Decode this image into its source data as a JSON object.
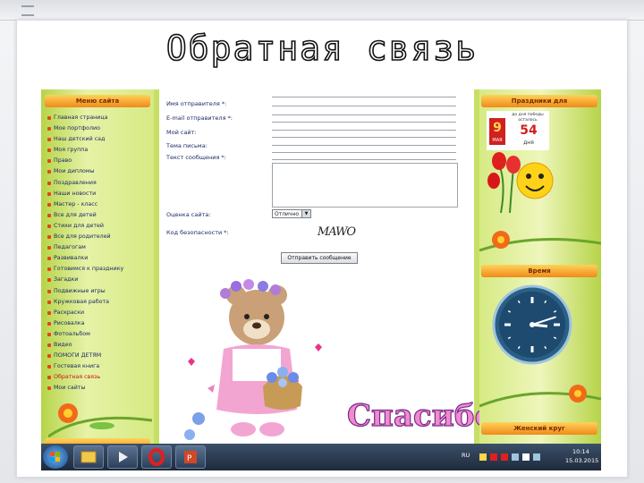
{
  "slide": {
    "title": "Обратная связь"
  },
  "site": {
    "left_block": {
      "header": "Меню сайта"
    },
    "menu_items": [
      "Главная страница",
      "Мое портфолио",
      "Наш детский сад",
      "Моя группа",
      "Право",
      "Мои дипломы",
      "Поздравления",
      "Наши новости",
      "Мастер - класс",
      "Все для детей",
      "Стихи для детей",
      "Все для родителей",
      "Педагогам",
      "Развивалки",
      "Готовимся к празднику",
      "Загадки",
      "Подвижные игры",
      "Кружковая работа",
      "Раскраски",
      "Рисовалка",
      "Фотоальбом",
      "Видео",
      "ПОМОГИ ДЕТЯМ",
      "Гостевая книга",
      "Обратная связь",
      "Мои сайты"
    ],
    "active_menu_item": "Обратная связь",
    "form": {
      "name_label": "Имя отправителя *:",
      "email_label": "E-mail отправителя *:",
      "site_label": "Мой сайт:",
      "subject_label": "Тема письма:",
      "message_label": "Текст сообщения *:",
      "rating_label": "Оценка сайта:",
      "rating_value": "Отлично",
      "captcha_label": "Код безопасности *:",
      "captcha_text": "MAWO",
      "submit_label": "Отправить сообщение",
      "thanks_text": "Спасибо"
    },
    "right_blocks": {
      "holidays_header": "Праздники для",
      "holiday_line1": "до дня победы",
      "holiday_line2": "осталось",
      "holiday_days": "54",
      "holiday_unit": "дня",
      "holiday_date_num": "9",
      "holiday_date_month": "МАЯ",
      "time_header": "Время",
      "bottom_header": "Женский круг"
    },
    "clock": {
      "hour": 3,
      "minute": 12
    }
  },
  "taskbar": {
    "language": "RU",
    "time": "10:14",
    "date": "15.03.2015"
  },
  "colors": {
    "accent_orange": "#f08a1a",
    "site_green": "#c8df66",
    "link_blue": "#1d2a66",
    "active_red": "#c81414"
  }
}
